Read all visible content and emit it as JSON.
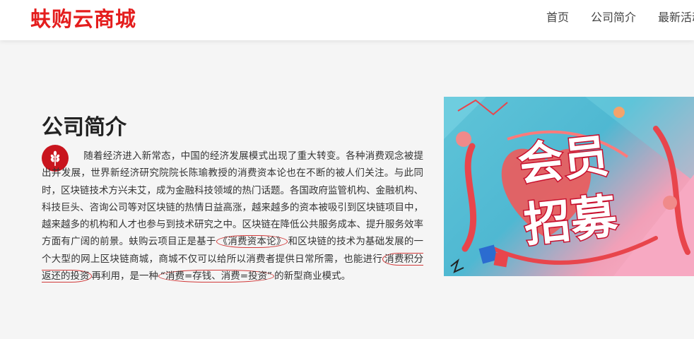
{
  "header": {
    "logo": "蚨购云商城",
    "nav": [
      "首页",
      "公司简介",
      "最新活动"
    ]
  },
  "main": {
    "title": "公司简介",
    "paragraph_parts": [
      "随着经济进入新常态，中国的经济发展模式出现了重大转变。各种消费观念被提出并发展，世界新经济研究院院长陈瑜教授的消费资本论也在不断的被人们关注。与此同时，区块链技术方兴未艾，成为金融科技领域的热门话题。各国政府监管机构、金融机构、科技巨头、咨询公司等对区块链的热情日益高涨，越来越多的资本被吸引到区块链项目中，越来越多的机构和人才也参与到技术研究之中。区块链在降低公共服务成本、提升服务效率方面有广阔的前景。蚨购云项目正是基于",
      "《消费资本论》",
      "和区块链的技术为基础发展的一个大型的网上区块链商城，商城不仅可以给所以消费者提供日常所需，也能进行",
      "消费积分返还的投资",
      "再利用，是一种",
      "“消费=存钱、消费=投资”",
      "的新型商业模式。"
    ]
  },
  "banner": {
    "text_line1": "会员",
    "text_line2": "招募"
  },
  "colors": {
    "brand": "#e41d1d",
    "badge": "#c9151e"
  },
  "icons": {
    "badge": "wheat-icon"
  }
}
